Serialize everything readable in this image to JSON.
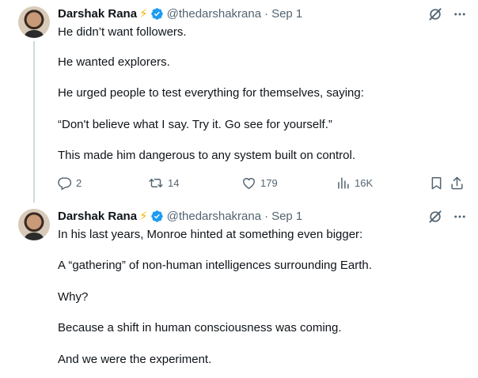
{
  "tweets": [
    {
      "author": {
        "name": "Darshak Rana",
        "emoji": "⚡",
        "handle": "@thedarshakrana",
        "date": "Sep 1"
      },
      "paragraphs": [
        "He didn’t want followers.",
        "He wanted explorers.",
        "He urged people to test everything for themselves, saying:",
        "“Don't believe what I say. Try it. Go see for yourself.”",
        "This made him dangerous to any system built on control."
      ],
      "stats": {
        "replies": "2",
        "reposts": "14",
        "likes": "179",
        "views": "16K"
      }
    },
    {
      "author": {
        "name": "Darshak Rana",
        "emoji": "⚡",
        "handle": "@thedarshakrana",
        "date": "Sep 1"
      },
      "paragraphs": [
        "In his last years, Monroe hinted at something even bigger:",
        "A “gathering” of non-human intelligences surrounding Earth.",
        "Why?",
        "Because a shift in human consciousness was coming.",
        "And we were the experiment."
      ]
    }
  ],
  "separator": "·",
  "colors": {
    "text_primary": "#0f1419",
    "text_secondary": "#536471",
    "verified_blue": "#1d9bf0",
    "thread_line": "#cfd9de"
  },
  "icons": {
    "header": [
      "verified-badge-icon",
      "grok-icon",
      "more-icon"
    ],
    "actions": [
      "reply-icon",
      "repost-icon",
      "like-icon",
      "views-icon",
      "bookmark-icon",
      "share-icon"
    ]
  }
}
